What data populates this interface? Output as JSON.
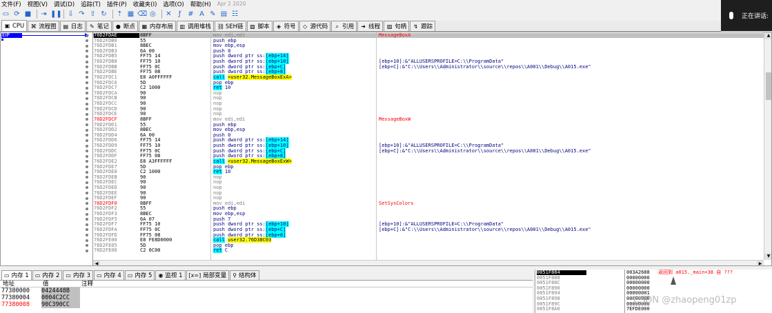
{
  "menu": {
    "items": [
      "文件(F)",
      "视图(V)",
      "调试(D)",
      "追踪(T)",
      "插件(P)",
      "收藏夹(I)",
      "选项(O)",
      "帮助(H)"
    ],
    "version": "Apr 2 2020"
  },
  "voice": {
    "label": "正在讲话:"
  },
  "tabs": [
    {
      "label": "CPU",
      "icon": "cpu-icon",
      "glyph": "▣",
      "active": true
    },
    {
      "label": "流程图",
      "icon": "graph-icon",
      "glyph": "⌘",
      "active": false
    },
    {
      "label": "日志",
      "icon": "log-icon",
      "glyph": "▤",
      "active": false
    },
    {
      "label": "笔记",
      "icon": "notes-icon",
      "glyph": "✎",
      "active": false
    },
    {
      "label": "断点",
      "icon": "breakpoint-icon",
      "glyph": "●",
      "active": false
    },
    {
      "label": "内存布局",
      "icon": "memory-map-icon",
      "glyph": "▦",
      "active": false
    },
    {
      "label": "调用堆栈",
      "icon": "call-stack-icon",
      "glyph": "▥",
      "active": false
    },
    {
      "label": "SEH链",
      "icon": "seh-icon",
      "glyph": "⛓",
      "active": false
    },
    {
      "label": "脚本",
      "icon": "script-icon",
      "glyph": "▧",
      "active": false
    },
    {
      "label": "符号",
      "icon": "symbols-icon",
      "glyph": "◈",
      "active": false
    },
    {
      "label": "源代码",
      "icon": "source-icon",
      "glyph": "◇",
      "active": false
    },
    {
      "label": "引用",
      "icon": "references-icon",
      "glyph": "⌕",
      "active": false
    },
    {
      "label": "线程",
      "icon": "threads-icon",
      "glyph": "➜",
      "active": false
    },
    {
      "label": "句柄",
      "icon": "handles-icon",
      "glyph": "▨",
      "active": false
    },
    {
      "label": "跟踪",
      "icon": "trace-icon",
      "glyph": "↯",
      "active": false
    }
  ],
  "eip_label": "EIP",
  "disasm": [
    {
      "addr": "76D2FDAE",
      "bytes": "8BFF",
      "instr": "mov edi,edi",
      "cmt": "MessageBoxA",
      "kind": "nop-grey",
      "label": true,
      "sel": true
    },
    {
      "addr": "76D2FDB0",
      "bytes": "55",
      "instr": "push ebp",
      "cmt": "",
      "kind": "normal"
    },
    {
      "addr": "76D2FDB1",
      "bytes": "8BEC",
      "instr": "mov ebp,esp",
      "cmt": "",
      "kind": "normal"
    },
    {
      "addr": "76D2FDB3",
      "bytes": "6A 00",
      "instr": "push 0",
      "cmt": "",
      "kind": "normal"
    },
    {
      "addr": "76D2FDB5",
      "bytes": "FF75 14",
      "instr": "push dword ptr ss:",
      "op": "[ebp+14]",
      "cmt": "",
      "kind": "mem"
    },
    {
      "addr": "76D2FDB8",
      "bytes": "FF75 10",
      "instr": "push dword ptr ss:",
      "op": "[ebp+10]",
      "cmt": "[ebp+10]:&\"ALLUSERSPROFILE=C:\\\\ProgramData\"",
      "kind": "mem"
    },
    {
      "addr": "76D2FDBB",
      "bytes": "FF75 0C",
      "instr": "push dword ptr ss:",
      "op": "[ebp+C]",
      "cmt": "[ebp+C]:&\"C:\\\\Users\\\\Administrator\\\\source\\\\repos\\\\A001\\\\Debug\\\\A015.exe\"",
      "kind": "mem"
    },
    {
      "addr": "76D2FDBE",
      "bytes": "FF75 08",
      "instr": "push dword ptr ss:",
      "op": "[ebp+8]",
      "cmt": "",
      "kind": "mem"
    },
    {
      "addr": "76D2FDC1",
      "bytes": "E8 A0FFFFFF",
      "instr": "call",
      "op": "<user32.MessageBoxExA>",
      "cmt": "",
      "kind": "call"
    },
    {
      "addr": "76D2FDC6",
      "bytes": "5D",
      "instr": "pop ebp",
      "cmt": "",
      "kind": "normal"
    },
    {
      "addr": "76D2FDC7",
      "bytes": "C2 1000",
      "instr": "ret",
      "op": "10",
      "cmt": "",
      "kind": "ret"
    },
    {
      "addr": "76D2FDCA",
      "bytes": "90",
      "instr": "nop",
      "cmt": "",
      "kind": "nop-grey"
    },
    {
      "addr": "76D2FDCB",
      "bytes": "90",
      "instr": "nop",
      "cmt": "",
      "kind": "nop-grey"
    },
    {
      "addr": "76D2FDCC",
      "bytes": "90",
      "instr": "nop",
      "cmt": "",
      "kind": "nop-grey"
    },
    {
      "addr": "76D2FDCD",
      "bytes": "90",
      "instr": "nop",
      "cmt": "",
      "kind": "nop-grey"
    },
    {
      "addr": "76D2FDCE",
      "bytes": "90",
      "instr": "nop",
      "cmt": "",
      "kind": "nop-grey"
    },
    {
      "addr": "76D2FDCF",
      "bytes": "8BFF",
      "instr": "mov edi,edi",
      "cmt": "MessageBoxW",
      "kind": "nop-grey",
      "label": true
    },
    {
      "addr": "76D2FDD1",
      "bytes": "55",
      "instr": "push ebp",
      "cmt": "",
      "kind": "normal"
    },
    {
      "addr": "76D2FDD2",
      "bytes": "8BEC",
      "instr": "mov ebp,esp",
      "cmt": "",
      "kind": "normal"
    },
    {
      "addr": "76D2FDD4",
      "bytes": "6A 00",
      "instr": "push 0",
      "cmt": "",
      "kind": "normal"
    },
    {
      "addr": "76D2FDD6",
      "bytes": "FF75 14",
      "instr": "push dword ptr ss:",
      "op": "[ebp+14]",
      "cmt": "",
      "kind": "mem"
    },
    {
      "addr": "76D2FDD9",
      "bytes": "FF75 10",
      "instr": "push dword ptr ss:",
      "op": "[ebp+10]",
      "cmt": "[ebp+10]:&\"ALLUSERSPROFILE=C:\\\\ProgramData\"",
      "kind": "mem"
    },
    {
      "addr": "76D2FDDC",
      "bytes": "FF75 0C",
      "instr": "push dword ptr ss:",
      "op": "[ebp+C]",
      "cmt": "[ebp+C]:&\"C:\\\\Users\\\\Administrator\\\\source\\\\repos\\\\A001\\\\Debug\\\\A015.exe\"",
      "kind": "mem"
    },
    {
      "addr": "76D2FDDF",
      "bytes": "FF75 08",
      "instr": "push dword ptr ss:",
      "op": "[ebp+8]",
      "cmt": "",
      "kind": "mem"
    },
    {
      "addr": "76D2FDE2",
      "bytes": "E8 A3FFFFFF",
      "instr": "call",
      "op": "<user32.MessageBoxExW>",
      "cmt": "",
      "kind": "call"
    },
    {
      "addr": "76D2FDE7",
      "bytes": "5D",
      "instr": "pop ebp",
      "cmt": "",
      "kind": "normal"
    },
    {
      "addr": "76D2FDE8",
      "bytes": "C2 1000",
      "instr": "ret",
      "op": "10",
      "cmt": "",
      "kind": "ret"
    },
    {
      "addr": "76D2FDEB",
      "bytes": "90",
      "instr": "nop",
      "cmt": "",
      "kind": "nop-grey"
    },
    {
      "addr": "76D2FDEC",
      "bytes": "90",
      "instr": "nop",
      "cmt": "",
      "kind": "nop-grey"
    },
    {
      "addr": "76D2FDED",
      "bytes": "90",
      "instr": "nop",
      "cmt": "",
      "kind": "nop-grey"
    },
    {
      "addr": "76D2FDEE",
      "bytes": "90",
      "instr": "nop",
      "cmt": "",
      "kind": "nop-grey"
    },
    {
      "addr": "76D2FDEF",
      "bytes": "90",
      "instr": "nop",
      "cmt": "",
      "kind": "nop-grey"
    },
    {
      "addr": "76D2FDF0",
      "bytes": "8BFF",
      "instr": "mov edi,edi",
      "cmt": "SetSysColors",
      "kind": "nop-grey",
      "label": true
    },
    {
      "addr": "76D2FDF2",
      "bytes": "55",
      "instr": "push ebp",
      "cmt": "",
      "kind": "normal"
    },
    {
      "addr": "76D2FDF3",
      "bytes": "8BEC",
      "instr": "mov ebp,esp",
      "cmt": "",
      "kind": "normal"
    },
    {
      "addr": "76D2FDF5",
      "bytes": "6A 07",
      "instr": "push 7",
      "cmt": "",
      "kind": "normal"
    },
    {
      "addr": "76D2FDF7",
      "bytes": "FF75 10",
      "instr": "push dword ptr ss:",
      "op": "[ebp+10]",
      "cmt": "[ebp+10]:&\"ALLUSERSPROFILE=C:\\\\ProgramData\"",
      "kind": "mem"
    },
    {
      "addr": "76D2FDFA",
      "bytes": "FF75 0C",
      "instr": "push dword ptr ss:",
      "op": "[ebp+C]",
      "cmt": "[ebp+C]:&\"C:\\\\Users\\\\Administrator\\\\source\\\\repos\\\\A001\\\\Debug\\\\A015.exe\"",
      "kind": "mem"
    },
    {
      "addr": "76D2FDFD",
      "bytes": "FF75 08",
      "instr": "push dword ptr ss:",
      "op": "[ebp+8]",
      "cmt": "",
      "kind": "mem"
    },
    {
      "addr": "76D2FE00",
      "bytes": "E8 FE8D0000",
      "instr": "call",
      "op": "user32.76D38C03",
      "cmt": "",
      "kind": "call"
    },
    {
      "addr": "76D2FE05",
      "bytes": "5D",
      "instr": "pop ebp",
      "cmt": "",
      "kind": "normal"
    },
    {
      "addr": "76D2FE06",
      "bytes": "C2 0C00",
      "instr": "ret",
      "op": "C",
      "cmt": "",
      "kind": "ret"
    }
  ],
  "dump_tabs": [
    {
      "label": "内存 1",
      "icon": "memory-icon",
      "glyph": "▭",
      "active": true
    },
    {
      "label": "内存 2",
      "icon": "memory-icon",
      "glyph": "▭",
      "active": false
    },
    {
      "label": "内存 3",
      "icon": "memory-icon",
      "glyph": "▭",
      "active": false
    },
    {
      "label": "内存 4",
      "icon": "memory-icon",
      "glyph": "▭",
      "active": false
    },
    {
      "label": "内存 5",
      "icon": "memory-icon",
      "glyph": "▭",
      "active": false
    },
    {
      "label": "监视 1",
      "icon": "watch-icon",
      "glyph": "◉",
      "active": false
    },
    {
      "label": "局部变量",
      "icon": "locals-icon",
      "glyph": "[x=]",
      "active": false
    },
    {
      "label": "结构体",
      "icon": "struct-icon",
      "glyph": "⚲",
      "active": false
    }
  ],
  "dump_headers": {
    "addr": "地址",
    "val": "值",
    "cmt": "注释"
  },
  "dump_rows": [
    {
      "addr": "77380000",
      "val": "0424448B",
      "red": false
    },
    {
      "addr": "77380004",
      "val": "0004C2CC",
      "red": false
    },
    {
      "addr": "77380008",
      "val": "90C390CC",
      "red": true
    }
  ],
  "stack_addrs": [
    "0051F884",
    "0051F888",
    "0051F88C",
    "0051F890",
    "0051F894",
    "0051F898",
    "0051F89C",
    "0051F8A0"
  ],
  "stack_vals": [
    "003A2688",
    "00000000",
    "00000000",
    "00000000",
    "00000001",
    "00000000",
    "00000000",
    "7EFDE000"
  ],
  "stack_comment": "返回到 a015._main+38 自 ???",
  "watermark": "CSDN @zhaopeng01zp",
  "colors": {
    "eip": "#0000ff",
    "address_grey": "#7f7f7f",
    "label_red": "#ff0000",
    "operand_cyan": "#00ffff",
    "call_yellow": "#ffff00",
    "code_navy": "#000080"
  }
}
